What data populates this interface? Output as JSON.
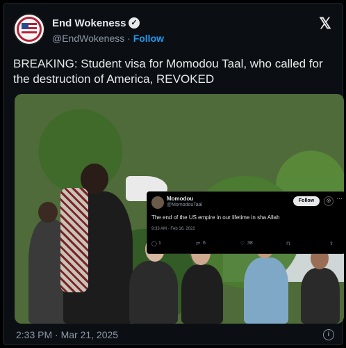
{
  "account": {
    "name": "End Wokeness",
    "handle": "@EndWokeness",
    "separator": "·",
    "follow_label": "Follow",
    "verified_icon": "verified-badge-icon"
  },
  "tweet": {
    "text": "BREAKING: Student visa for Momodou Taal, who called for the destruction of America, REVOKED",
    "timestamp": "2:33 PM · Mar 21, 2025"
  },
  "embedded_tweet": {
    "name": "Momodou",
    "handle": "@MomodouTaal",
    "follow_label": "Follow",
    "text": "The end of the US empire in our lifetime in sha Allah",
    "date": "9:33 AM · Feb 16, 2022",
    "replies": "1",
    "reposts": "6",
    "likes": "38"
  },
  "colors": {
    "background": "#0b0f14",
    "link": "#1d9bf0",
    "text": "#e7e9ea",
    "muted": "#8b98a5"
  }
}
